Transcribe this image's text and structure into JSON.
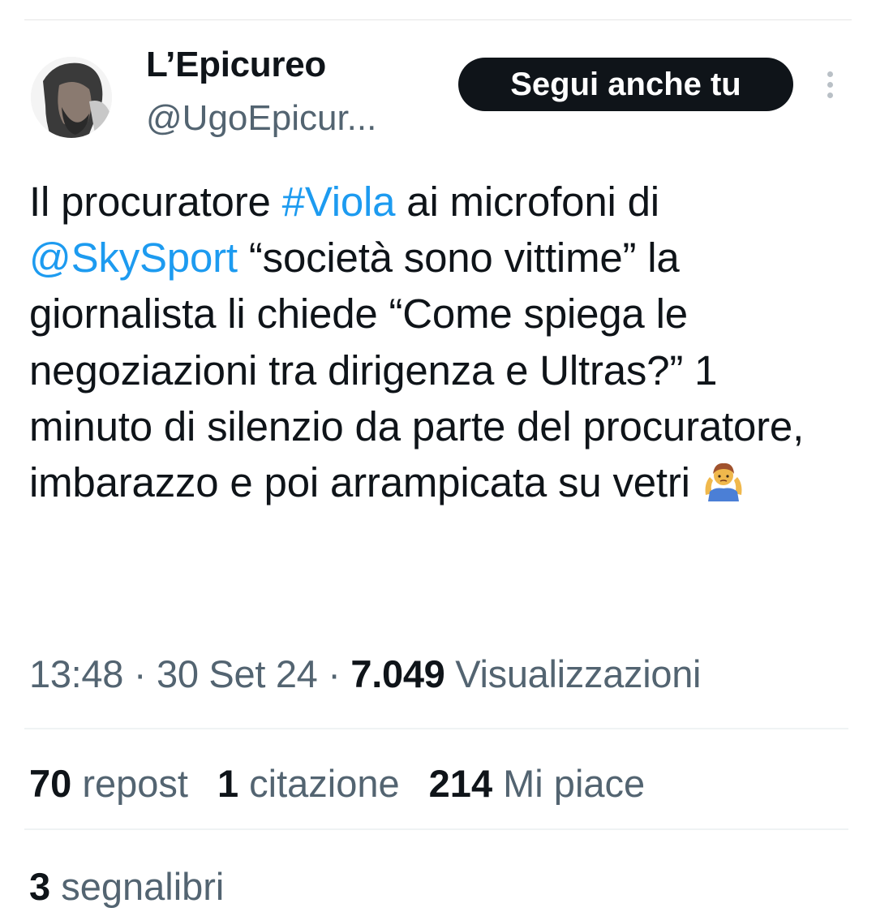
{
  "author": {
    "display_name": "L’Epicureo",
    "handle": "@UgoEpicur..."
  },
  "follow_button": {
    "label": "Segui anche tu"
  },
  "tweet": {
    "text_1": "Il procuratore ",
    "hashtag": "#Viola",
    "text_2": " ai microfoni di ",
    "mention": "@SkySport",
    "text_3": " “società sono vittime” la giornalista li chiede “Come spiega le negoziazioni tra dirigenza e Ultras?” 1 minuto di silenzio da parte del procuratore, imbarazzo e poi arrampicata su vetri "
  },
  "meta": {
    "time": "13:48",
    "sep1": " · ",
    "date": "30 Set 24",
    "sep2": " · ",
    "views_count": "7.049",
    "views_label": " Visualizzazioni"
  },
  "stats": {
    "reposts_count": "70",
    "reposts_label": " repost",
    "quotes_count": "1",
    "quotes_label": " citazione",
    "likes_count": "214",
    "likes_label": " Mi piace"
  },
  "bookmarks": {
    "count": "3",
    "label": " segnalibri"
  },
  "colors": {
    "link": "#1d9bf0",
    "text": "#0f1419",
    "muted": "#536471",
    "button_bg": "#0f1419"
  },
  "icons": {
    "more": "more-vertical-icon",
    "emoji": "person-shrugging-icon"
  }
}
